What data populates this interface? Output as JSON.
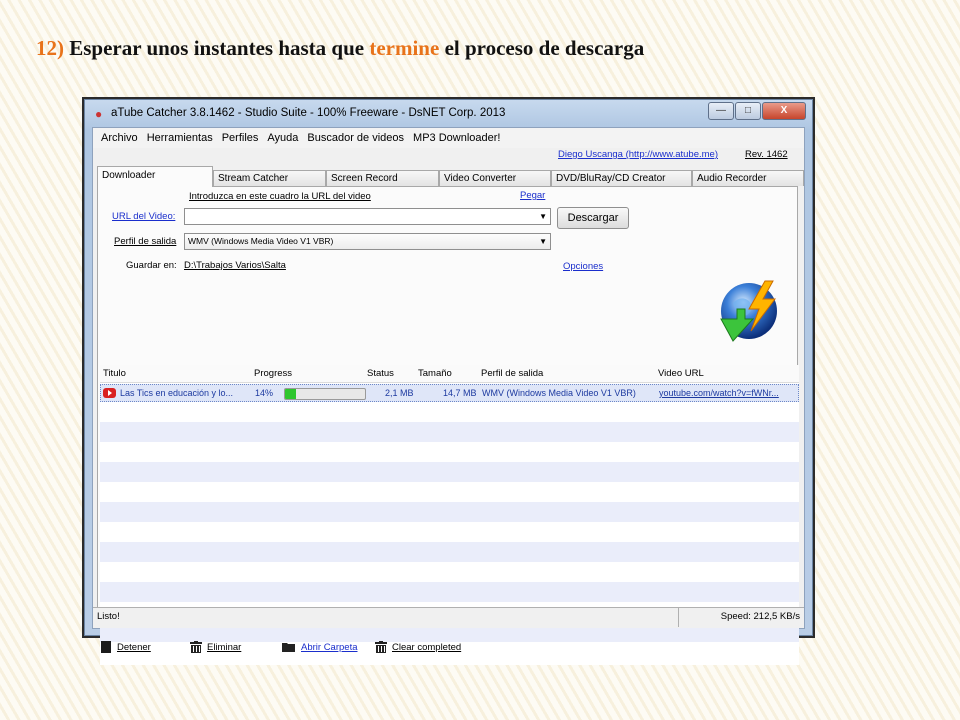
{
  "slide": {
    "title_num": "12)",
    "title_pre": " Esperar unos instantes hasta que ",
    "title_hl": "termine",
    "title_post": " el proceso de descarga"
  },
  "window": {
    "title": "aTube Catcher 3.8.1462 - Studio Suite - 100% Freeware - DsNET Corp. 2013",
    "minimize_glyph": "—",
    "maximize_glyph": "□",
    "close_glyph": "X"
  },
  "menu": [
    "Archivo",
    "Herramientas",
    "Perfiles",
    "Ayuda",
    "Buscador de videos",
    "MP3 Downloader!"
  ],
  "header_links": {
    "author": "Diego Uscanga (http://www.atube.me)",
    "revision": "Rev. 1462"
  },
  "tabs": [
    "Downloader",
    "Stream Catcher",
    "Screen Record",
    "Video Converter",
    "DVD/BluRay/CD Creator",
    "Audio Recorder"
  ],
  "form": {
    "hint": "Introduzca en este cuadro la URL del video",
    "paste": "Pegar",
    "url_label": "URL del Video:",
    "url_value": "",
    "download_button": "Descargar",
    "profile_label": "Perfil de salida",
    "profile_value": "WMV (Windows Media Video V1 VBR)",
    "save_label": "Guardar en:",
    "save_path": "D:\\Trabajos Varios\\Salta",
    "options": "Opciones"
  },
  "table": {
    "columns": [
      "Titulo",
      "Progress",
      "Status",
      "Tamaño",
      "Perfil de salida",
      "Video URL"
    ],
    "rows": [
      {
        "title": "Las Tics en educación y lo...",
        "progress_text": "14%",
        "progress": 0.14,
        "status": "2,1 MB",
        "size": "14,7 MB",
        "profile": "WMV (Windows Media Video V1 VBR)",
        "url": "youtube.com/watch?v=fWNr..."
      }
    ]
  },
  "actions": {
    "stop": "Detener",
    "delete": "Eliminar",
    "open_folder": "Abrir Carpeta",
    "clear": "Clear completed"
  },
  "status": {
    "text": "Listo!",
    "speed": "Speed: 212,5 KB/s"
  },
  "colors": {
    "title_highlight": "#e8731a",
    "link": "#1a2ecc",
    "progress_fill": "#2ec62e",
    "row_selected": "#dfe6f8"
  }
}
